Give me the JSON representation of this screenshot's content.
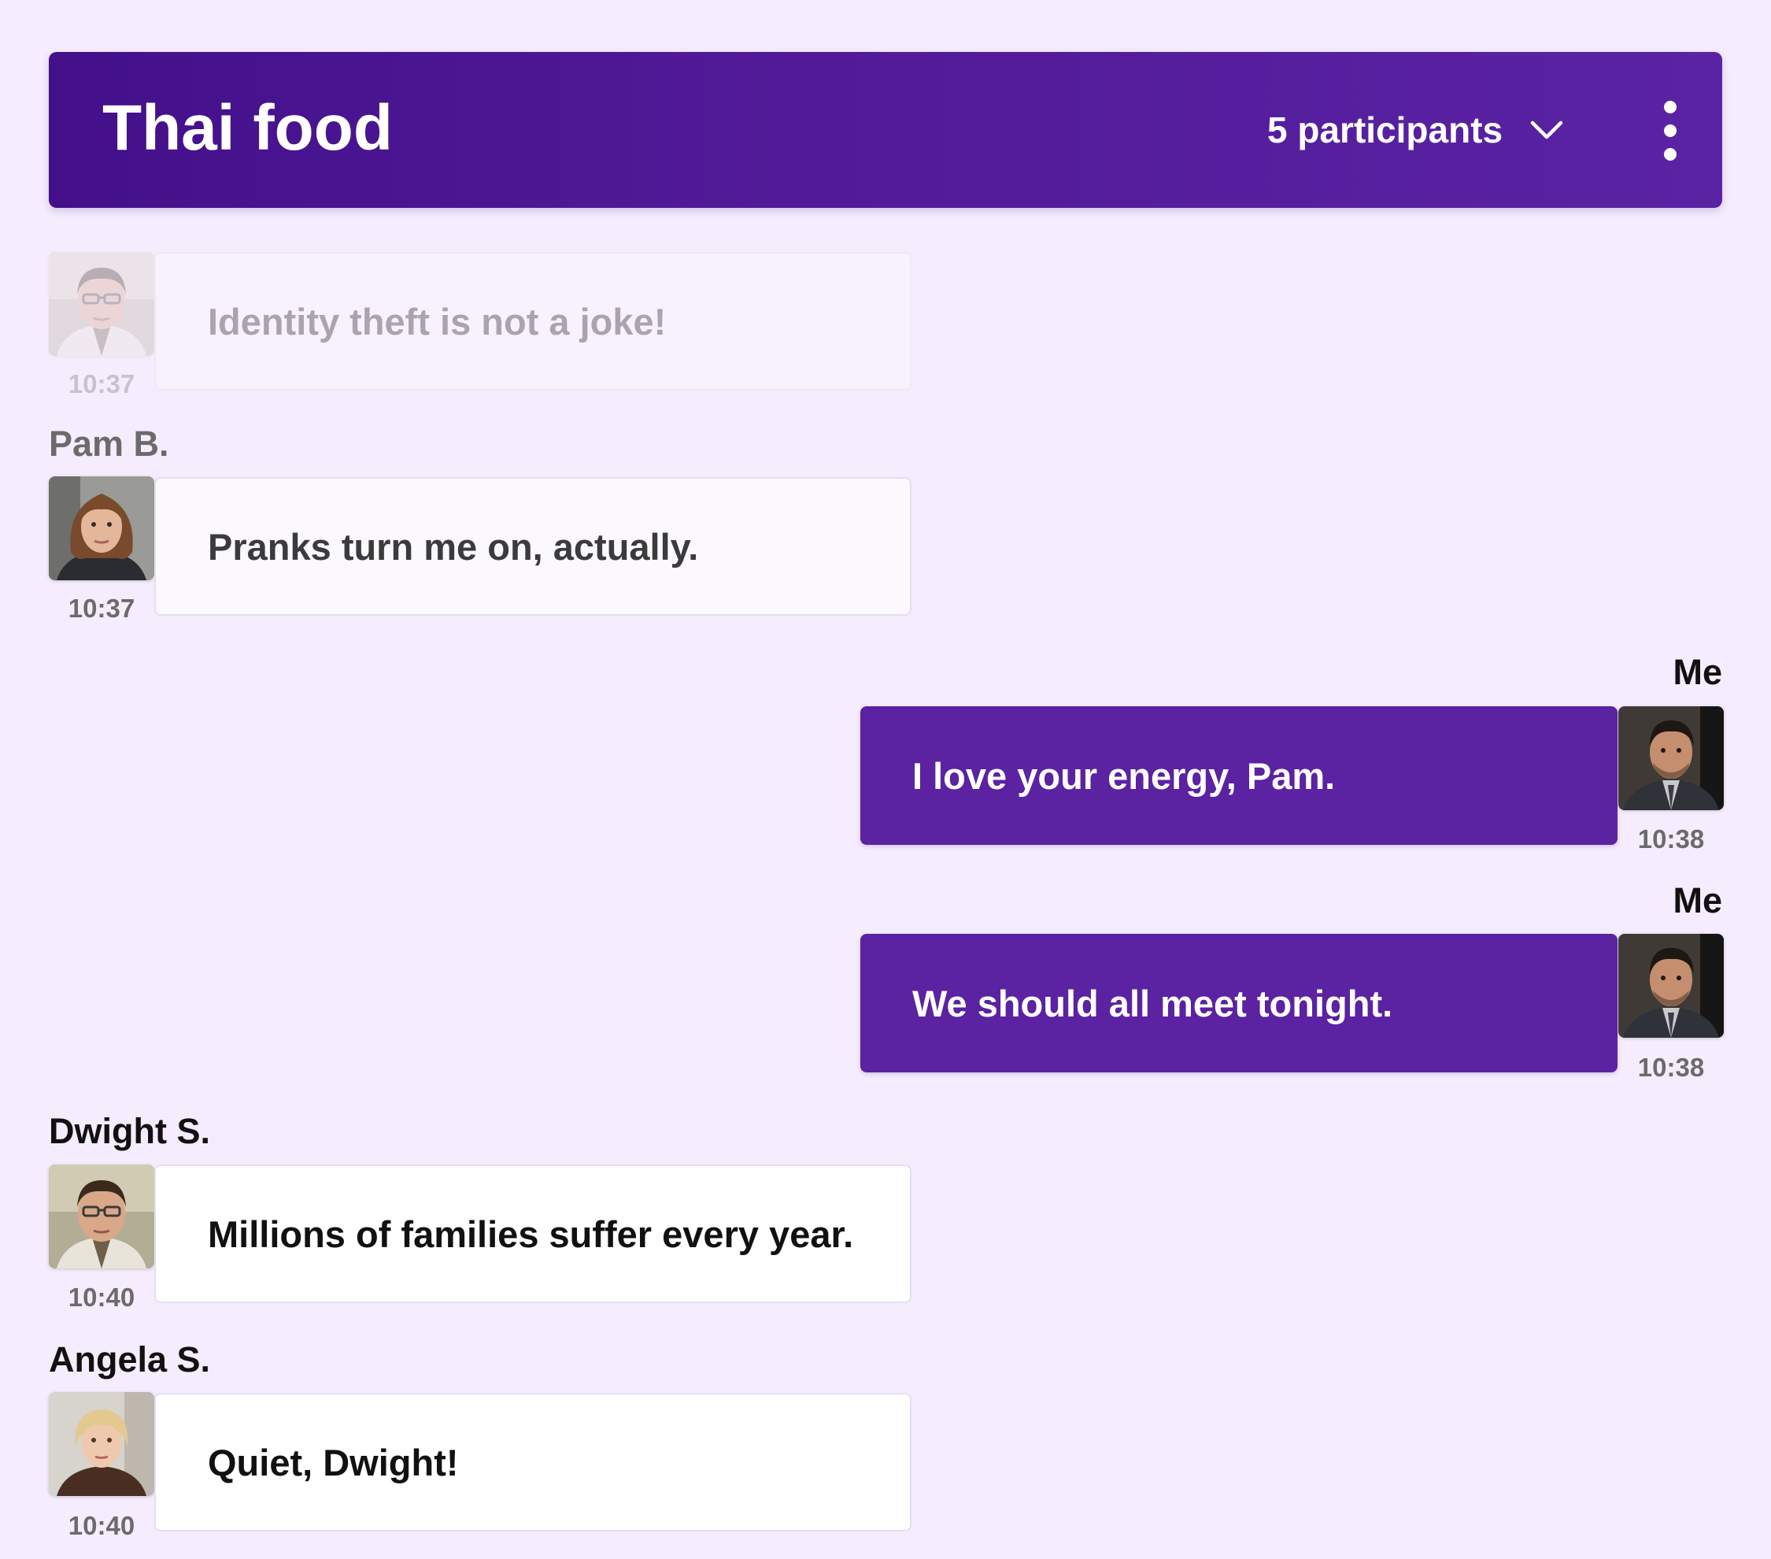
{
  "header": {
    "title": "Thai food",
    "participants_label": "5 participants",
    "participants_icon": "chevron-down-icon",
    "menu_icon": "more-vertical-icon"
  },
  "colors": {
    "header_bg": "#4b1594",
    "outgoing_bubble": "#5b22a1",
    "incoming_bubble": "#ffffff",
    "page_bg": "#f5ecfd"
  },
  "messages": [
    {
      "author": "",
      "text": "Identity theft is not a joke!",
      "time": "10:37",
      "avatar": "dwight-avatar",
      "direction": "incoming"
    },
    {
      "author": "Pam B.",
      "text": "Pranks turn me on, actually.",
      "time": "10:37",
      "avatar": "pam-avatar",
      "direction": "incoming"
    },
    {
      "author": "Me",
      "text": "I love your energy, Pam.",
      "time": "10:38",
      "avatar": "me-avatar",
      "direction": "outgoing"
    },
    {
      "author": "Me",
      "text": "We should all meet tonight.",
      "time": "10:38",
      "avatar": "me-avatar",
      "direction": "outgoing"
    },
    {
      "author": "Dwight S.",
      "text": "Millions of families suffer every year.",
      "time": "10:40",
      "avatar": "dwight-avatar",
      "direction": "incoming"
    },
    {
      "author": "Angela S.",
      "text": "Quiet, Dwight!",
      "time": "10:40",
      "avatar": "angela-avatar",
      "direction": "incoming"
    }
  ]
}
